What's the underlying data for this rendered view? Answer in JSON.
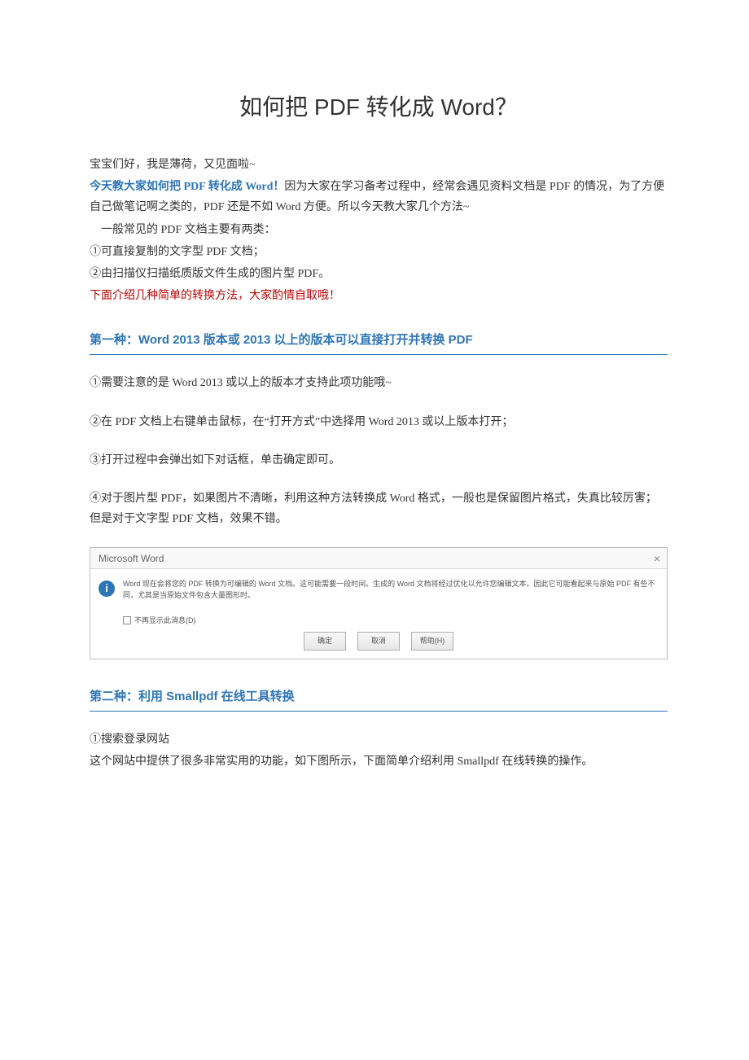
{
  "title": "如何把 PDF 转化成 Word？",
  "intro": {
    "greeting": "宝宝们好，我是薄荷，又见面啦~",
    "topic_lead": "今天教大家如何把 PDF 转化成 Word！",
    "topic_rest": "因为大家在学习备考过程中，经常会遇见资料文档是 PDF 的情况，为了方便自己做笔记啊之类的，PDF 还是不如 Word 方便。所以今天教大家几个方法~",
    "types_intro": "一般常见的 PDF 文档主要有两类：",
    "type1": "①可直接复制的文字型 PDF 文档；",
    "type2": "②由扫描仪扫描纸质版文件生成的图片型 PDF。",
    "note_red": "下面介绍几种简单的转换方法，大家酌情自取哦！"
  },
  "method1": {
    "heading": "第一种：Word 2013 版本或 2013 以上的版本可以直接打开并转换 PDF",
    "p1": "①需要注意的是 Word 2013 或以上的版本才支持此项功能哦~",
    "p2": "②在 PDF 文档上右键单击鼠标，在“打开方式”中选择用 Word 2013 或以上版本打开；",
    "p3": "③打开过程中会弹出如下对话框，单击确定即可。",
    "p4": "④对于图片型 PDF，如果图片不清晰，利用这种方法转换成 Word 格式，一般也是保留图片格式，失真比较厉害；但是对于文字型 PDF 文档，效果不错。"
  },
  "dialog": {
    "title": "Microsoft Word",
    "close": "×",
    "message": "Word 现在会将您的 PDF 转换为可编辑的 Word 文档。这可能需要一段时间。生成的 Word 文档将经过优化以允许您编辑文本。因此它可能看起来与原始 PDF 有些不同，尤其是当原始文件包含大量图形时。",
    "checkbox": "不再显示此消息(D)",
    "ok": "确定",
    "cancel": "取消",
    "help": "帮助(H)"
  },
  "method2": {
    "heading": "第二种：利用 Smallpdf 在线工具转换",
    "p1": "①搜索登录网站",
    "p2": "这个网站中提供了很多非常实用的功能，如下图所示，下面简单介绍利用 Smallpdf 在线转换的操作。"
  }
}
